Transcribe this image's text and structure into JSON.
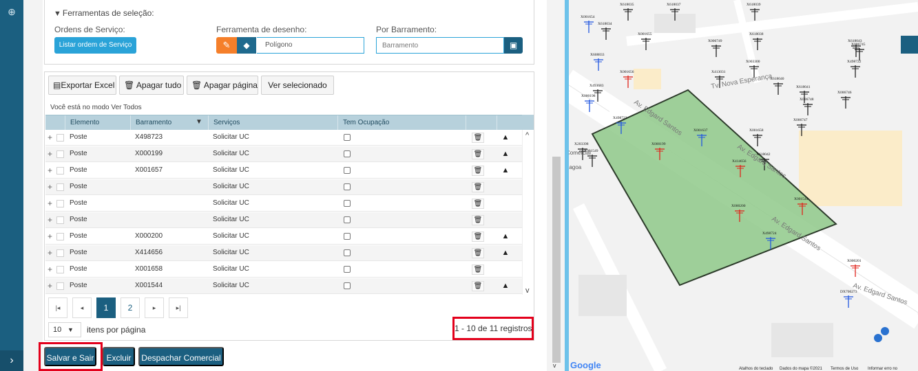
{
  "selection_tools": {
    "title": "Ferramentas de seleção:",
    "ordens_label": "Ordens de Serviço:",
    "listar_button": "Listar ordem de Serviço",
    "desenho_label": "Ferramenta de desenho:",
    "desenho_value": "Polígono",
    "barramento_label": "Por Barramento:",
    "barramento_placeholder": "Barramento"
  },
  "toolbar": {
    "exportar": "Exportar Excel",
    "apagar_tudo": "Apagar tudo",
    "apagar_pagina": "Apagar página",
    "ver_selecionado": "Ver selecionado"
  },
  "mode_text": "Você está no modo Ver Todos",
  "grid": {
    "columns": [
      "Elemento",
      "Barramento",
      "Serviços",
      "Tem Ocupação"
    ],
    "rows": [
      {
        "elemento": "Poste",
        "barramento": "X498723",
        "servicos": "Solicitar UC",
        "warn": true
      },
      {
        "elemento": "Poste",
        "barramento": "X000199",
        "servicos": "Solicitar UC",
        "warn": true
      },
      {
        "elemento": "Poste",
        "barramento": "X001657",
        "servicos": "Solicitar UC",
        "warn": true
      },
      {
        "elemento": "Poste",
        "barramento": "",
        "servicos": "Solicitar UC",
        "warn": false
      },
      {
        "elemento": "Poste",
        "barramento": "",
        "servicos": "Solicitar UC",
        "warn": false
      },
      {
        "elemento": "Poste",
        "barramento": "",
        "servicos": "Solicitar UC",
        "warn": false
      },
      {
        "elemento": "Poste",
        "barramento": "X000200",
        "servicos": "Solicitar UC",
        "warn": true
      },
      {
        "elemento": "Poste",
        "barramento": "X414656",
        "servicos": "Solicitar UC",
        "warn": true
      },
      {
        "elemento": "Poste",
        "barramento": "X001658",
        "servicos": "Solicitar UC",
        "warn": false
      },
      {
        "elemento": "Poste",
        "barramento": "X001544",
        "servicos": "Solicitar UC",
        "warn": true
      }
    ]
  },
  "pagination": {
    "pages": [
      "1",
      "2"
    ],
    "current": "1",
    "page_size": "10",
    "page_size_label": "itens por página",
    "records": "1 - 10 de 11 registros"
  },
  "actions": {
    "salvar": "Salvar e Sair",
    "excluir": "Excluir",
    "despachar": "Despachar Comercial"
  },
  "map": {
    "streets": [
      "Av. Edgard Santos",
      "Av. Edgard Santos",
      "Av. Edgard Santos",
      "Av. Edgard Santos",
      "Tv. Nova Esperança"
    ],
    "poles_red": [
      "X000199",
      "X414656",
      "X000200",
      "X001544",
      "X000201",
      "X001656"
    ],
    "poles_blue": [
      "X498723",
      "X001637",
      "X498724",
      "DX700273",
      "X001654",
      "X000198",
      "X608833"
    ],
    "poles_black": [
      "X618034",
      "X001655",
      "X006749",
      "X003300",
      "X618038",
      "X618039",
      "X413031",
      "X618040",
      "X618041",
      "X006746",
      "X006748",
      "X006747",
      "X001658",
      "X618042",
      "X618043",
      "X006745",
      "X498722",
      "X493683",
      "X203398",
      "X001549",
      "X618035",
      "X618037"
    ],
    "place_label": [
      "Comercial",
      "Lagoa"
    ],
    "google": "Google",
    "footer": [
      "Atalhos do teclado",
      "Dados do mapa ©2021",
      "Termos de Uso",
      "Informar erro no"
    ],
    "colors": {
      "polygon_fill": "#8fc98a",
      "polygon_stroke": "#2c3a2a",
      "pole_red": "#e0241b",
      "pole_blue": "#2458e0"
    }
  }
}
